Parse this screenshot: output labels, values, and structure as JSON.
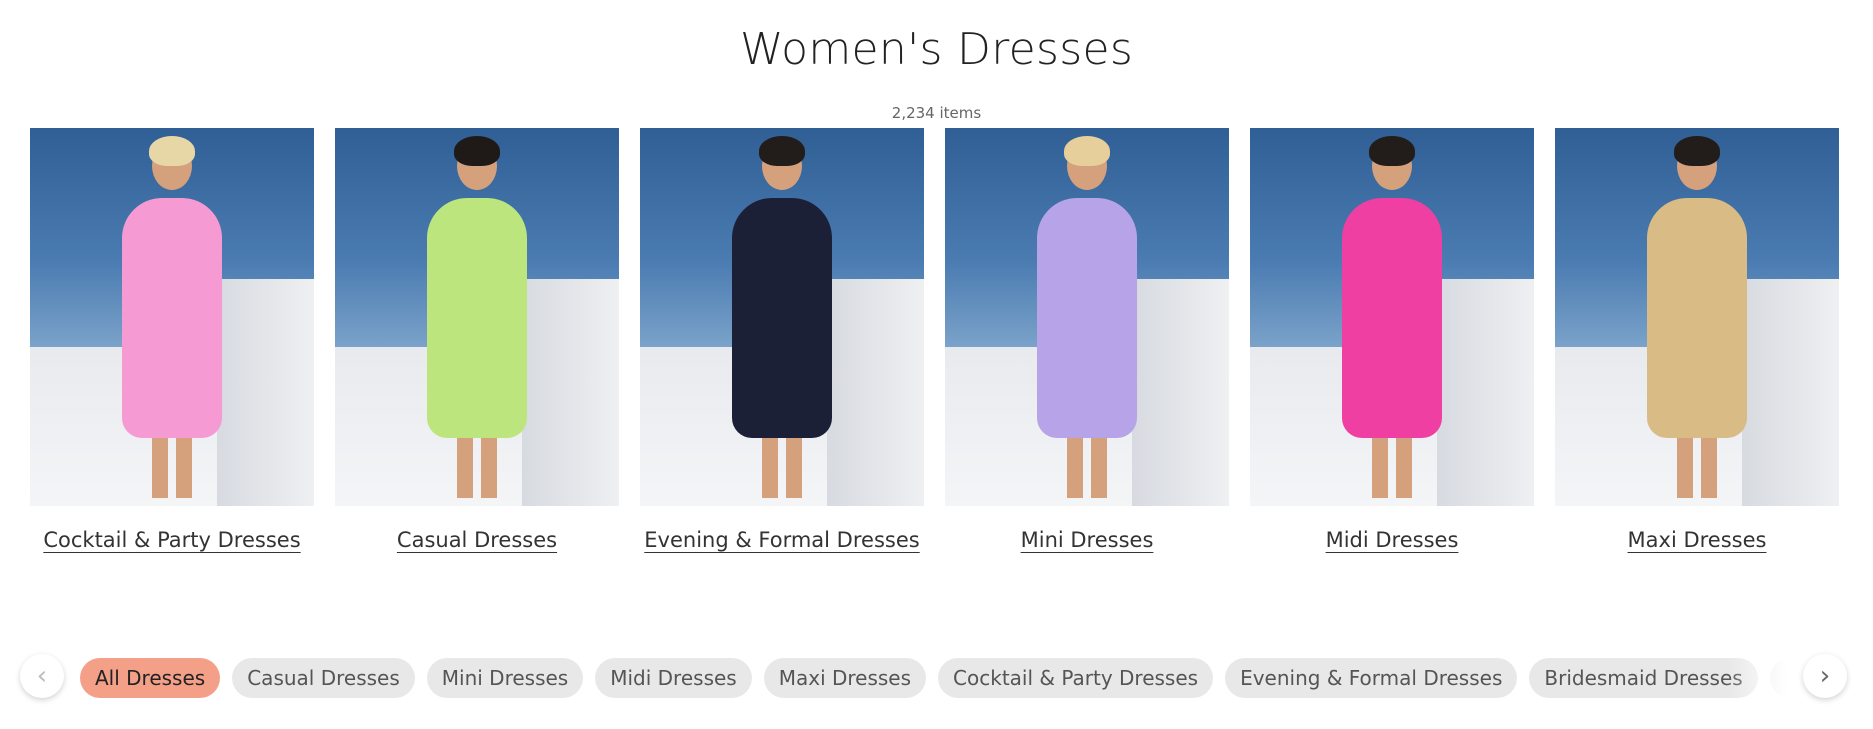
{
  "page": {
    "title": "Women's Dresses",
    "item_count": "2,234 items"
  },
  "categories": [
    {
      "label": "Cocktail & Party Dresses",
      "dress_color": "#f59ad3",
      "hair_color": "#e8d7a6"
    },
    {
      "label": "Casual Dresses",
      "dress_color": "#bce67d",
      "hair_color": "#1f1a18"
    },
    {
      "label": "Evening & Formal Dresses",
      "dress_color": "#1b2036",
      "hair_color": "#221c1a"
    },
    {
      "label": "Mini Dresses",
      "dress_color": "#b7a4e8",
      "hair_color": "#e6cf9a"
    },
    {
      "label": "Midi Dresses",
      "dress_color": "#f03fa3",
      "hair_color": "#221c1a"
    },
    {
      "label": "Maxi Dresses",
      "dress_color": "#d9bb86",
      "hair_color": "#221c1a"
    }
  ],
  "filters": {
    "chips": [
      {
        "label": "All Dresses",
        "active": true
      },
      {
        "label": "Casual Dresses",
        "active": false
      },
      {
        "label": "Mini Dresses",
        "active": false
      },
      {
        "label": "Midi Dresses",
        "active": false
      },
      {
        "label": "Maxi Dresses",
        "active": false
      },
      {
        "label": "Cocktail & Party Dresses",
        "active": false
      },
      {
        "label": "Evening & Formal Dresses",
        "active": false
      },
      {
        "label": "Bridesmaid Dresses",
        "active": false
      },
      {
        "label": "Mothe",
        "active": false
      }
    ],
    "prev_icon": "chevron-left-icon",
    "next_icon": "chevron-right-icon",
    "active_color": "#f4a089"
  }
}
